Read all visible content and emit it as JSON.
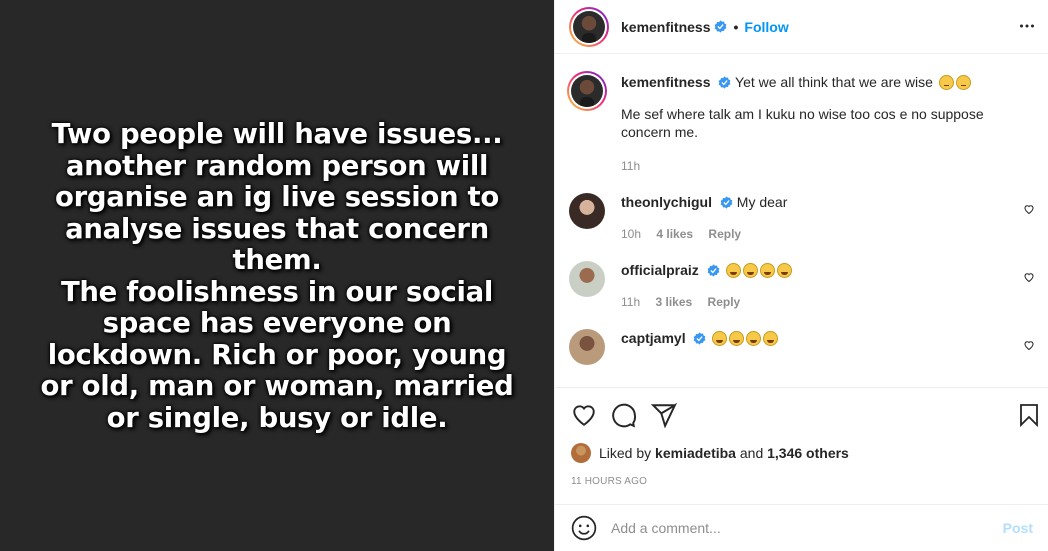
{
  "media": {
    "lines": [
      "Two people will have issues...",
      "another random person will",
      "organise an ig live session to",
      "analyse issues that concern",
      "them.",
      "The foolishness in our social",
      "space has everyone on",
      "lockdown. Rich or poor, young",
      "or old, man or woman, married",
      "or single, busy or idle."
    ]
  },
  "header": {
    "username": "kemenfitness",
    "separator": "•",
    "follow_label": "Follow",
    "more_icon": "more-horizontal-icon"
  },
  "caption": {
    "username": "kemenfitness",
    "text": "Yet we all think that we are wise",
    "emojis": [
      "neutral-face",
      "neutral-face"
    ],
    "text2": "Me sef where talk am I kuku no wise too cos e no suppose concern me.",
    "time": "11h"
  },
  "comments": [
    {
      "username": "theonlychigul",
      "text": "My dear",
      "emojis": [],
      "time": "10h",
      "likes": "4 likes",
      "reply": "Reply"
    },
    {
      "username": "officialpraiz",
      "text": "",
      "emojis": [
        "laughing",
        "laughing",
        "laughing",
        "laughing"
      ],
      "time": "11h",
      "likes": "3 likes",
      "reply": "Reply"
    },
    {
      "username": "captjamyl",
      "text": "",
      "emojis": [
        "laughing",
        "laughing",
        "laughing",
        "laughing"
      ],
      "time": "",
      "likes": "",
      "reply": ""
    }
  ],
  "likes": {
    "prefix": "Liked by",
    "user": "kemiadetiba",
    "conj": "and",
    "others": "1,346 others"
  },
  "timestamp": "11 HOURS AGO",
  "add_comment": {
    "placeholder": "Add a comment...",
    "post_label": "Post"
  },
  "colors": {
    "accent": "#0095f6",
    "post_disabled": "#b2dffc",
    "media_bg": "#282828"
  }
}
